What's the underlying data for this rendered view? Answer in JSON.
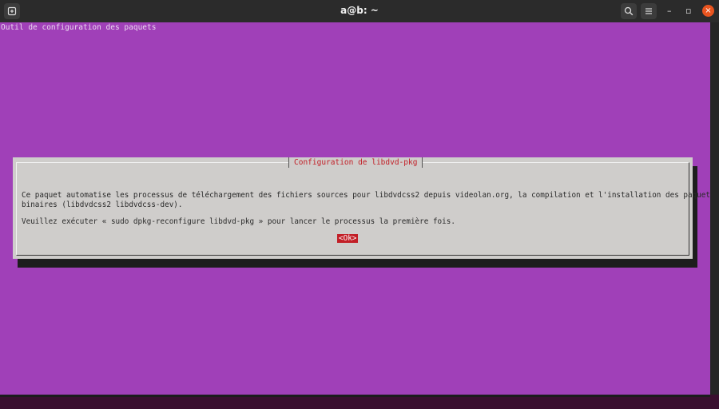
{
  "window": {
    "title": "a@b: ~",
    "new_tab_icon": "new-tab-icon",
    "search_icon": "search-icon",
    "menu_icon": "hamburger-menu-icon",
    "minimize_glyph": "–",
    "maximize_glyph": "▫",
    "close_glyph": "×",
    "close_color": "#e9541f"
  },
  "terminal": {
    "background_color": "#a040b8",
    "backtitle": "Outil de configuration des paquets"
  },
  "dialog": {
    "title": "Configuration de libdvd-pkg",
    "lines": [
      "Ce paquet automatise les processus de téléchargement des fichiers sources pour libdvdcss2 depuis videolan.org, la compilation et l'installation des paquets",
      "binaires (libdvdcss2 libdvdcss-dev).",
      "Veuillez exécuter « sudo dpkg-reconfigure libdvd-pkg » pour lancer le processus la première fois."
    ],
    "ok_button": "<Ok>",
    "accent_color": "#c21f27"
  }
}
